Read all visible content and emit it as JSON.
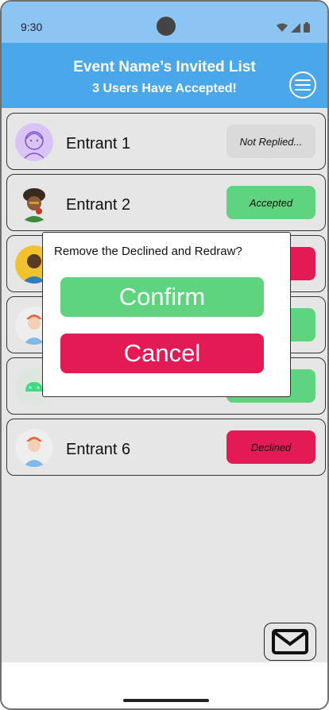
{
  "status_bar": {
    "time": "9:30"
  },
  "header": {
    "title": "Event Name’s Invited List",
    "subtitle": "3 Users Have Accepted!",
    "menu_icon": "hamburger-menu-icon"
  },
  "entrants": [
    {
      "name": "Entrant 1",
      "status": "Not Replied...",
      "status_color": "#dadada"
    },
    {
      "name": "Entrant 2",
      "status": "Accepted",
      "status_color": "#5ed47e"
    },
    {
      "name": "",
      "status": "",
      "status_color": "#e31a54"
    },
    {
      "name": "",
      "status": "",
      "status_color": "#5ed47e"
    },
    {
      "name": "",
      "status": "",
      "status_color": "#5ed47e"
    },
    {
      "name": "Entrant 6",
      "status": "Declined",
      "status_color": "#e31a54"
    }
  ],
  "dialog": {
    "message": "Remove the Declined and Redraw?",
    "confirm_label": "Confirm",
    "cancel_label": "Cancel"
  },
  "fab": {
    "icon": "mail-icon"
  },
  "colors": {
    "header_bg": "#4aa8ea",
    "status_bar_bg": "#8cc4f2",
    "accepted": "#5ed47e",
    "declined": "#e31a54",
    "not_replied": "#dadada"
  }
}
